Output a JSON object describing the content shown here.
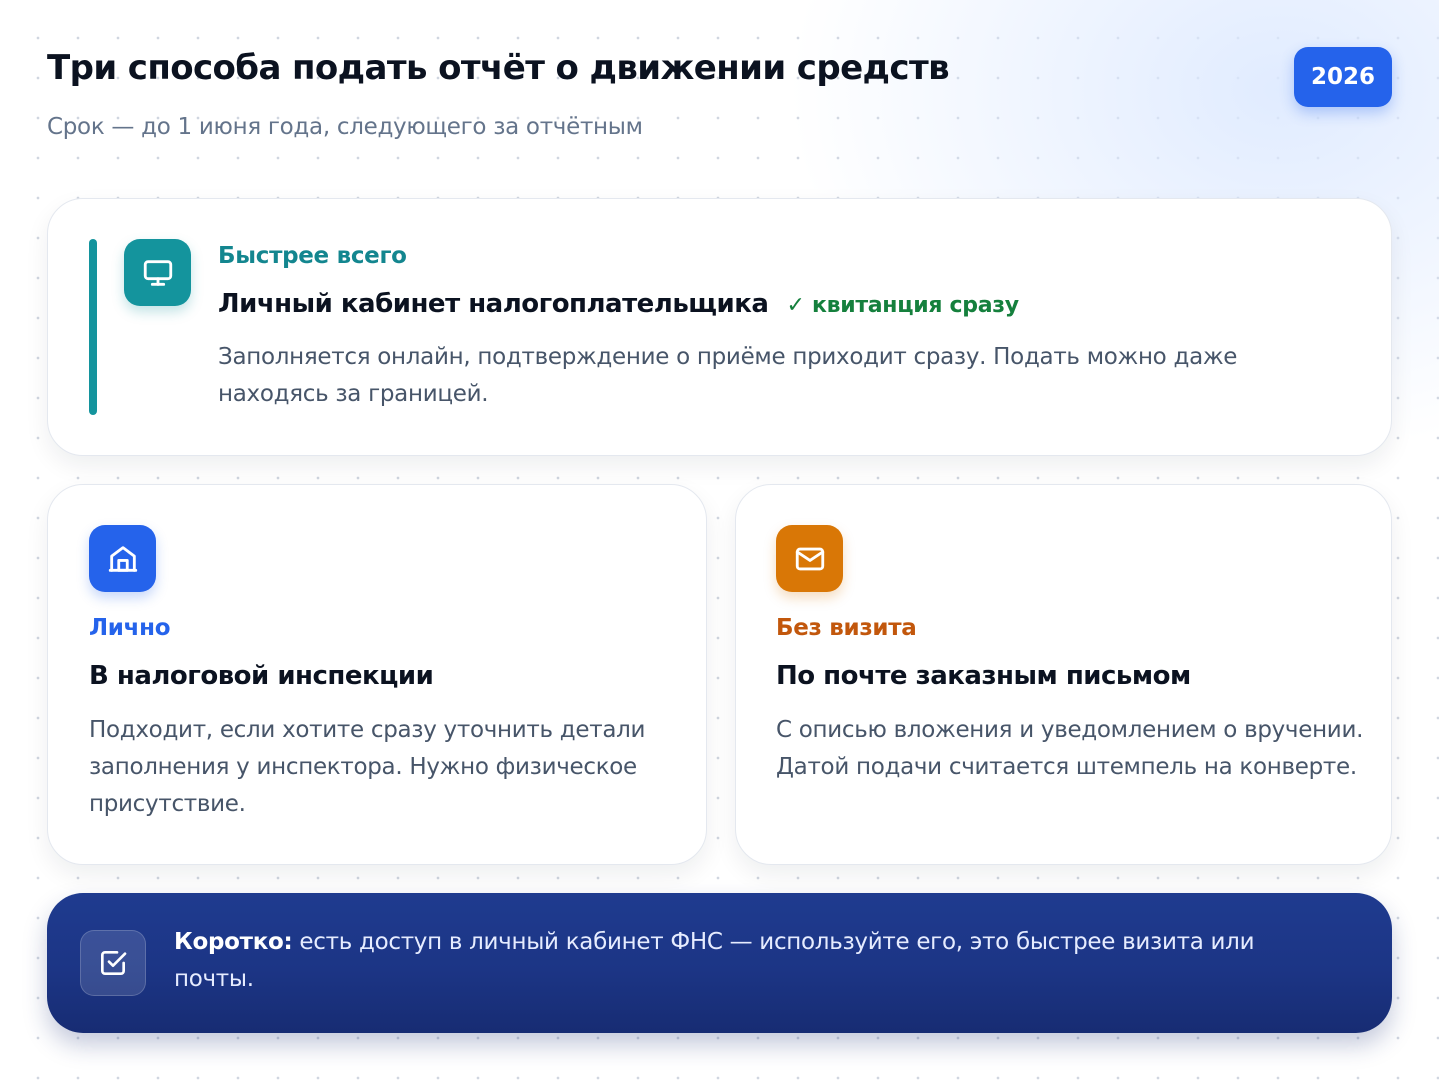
{
  "header": {
    "title": "Три способа подать отчёт о движении средств",
    "subtitle": "Срок — до 1 июня года, следующего за отчётным",
    "year_badge": "2026"
  },
  "colors": {
    "accent_teal": "#14949d",
    "accent_blue": "#2563eb",
    "accent_orange": "#d97706",
    "success_green": "#15803d",
    "summary_navy": "#1c3585"
  },
  "methods": [
    {
      "icon": "monitor-icon",
      "eyebrow": "Быстрее всего",
      "title": "Личный кабинет налогоплательщика",
      "tag": "✓ квитанция сразу",
      "description": "Заполняется онлайн, подтверждение о приёме приходит сразу. Подать можно даже находясь за границей."
    },
    {
      "icon": "building-icon",
      "eyebrow": "Лично",
      "title": "В налоговой инспекции",
      "description": "Подходит, если хотите сразу уточнить детали заполнения у инспектора. Нужно физическое присутствие."
    },
    {
      "icon": "envelope-icon",
      "eyebrow": "Без визита",
      "title": "По почте заказным письмом",
      "description": "С описью вложения и уведомлением о вручении. Датой подачи считается штемпель на конверте."
    }
  ],
  "summary": {
    "icon": "checkbox-icon",
    "label": "Коротко:",
    "text": " есть доступ в личный кабинет ФНС — используйте его, это быстрее визита или почты."
  }
}
